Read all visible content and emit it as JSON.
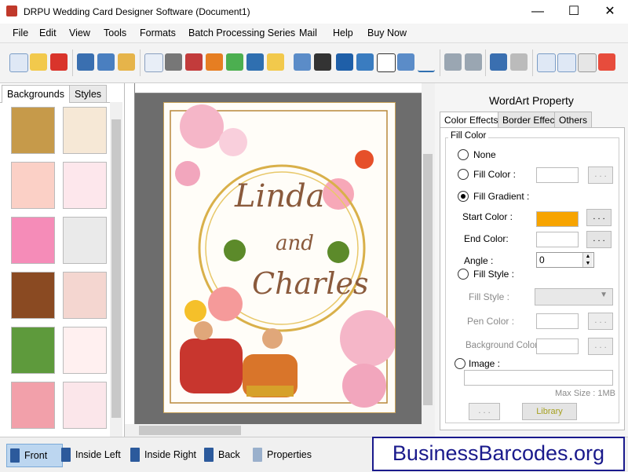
{
  "window": {
    "title": "DRPU Wedding Card Designer Software (Document1)",
    "controls": {
      "minimize": "—",
      "maximize": "☐",
      "close": "✕"
    }
  },
  "menu": [
    "File",
    "Edit",
    "View",
    "Tools",
    "Formats",
    "Batch Processing Series",
    "Mail",
    "Help",
    "Buy Now"
  ],
  "left_panel": {
    "tabs": [
      "Backgrounds",
      "Styles"
    ]
  },
  "card": {
    "name1": "Linda",
    "name2": "and",
    "name3": "Charles"
  },
  "wordart": {
    "title": "WordArt Property",
    "tabs": [
      "Color Effects",
      "Border Effect",
      "Others"
    ],
    "fill_color_group": "Fill Color",
    "none": "None",
    "fill_color": "Fill Color :",
    "fill_gradient": "Fill Gradient :",
    "start_color": "Start Color :",
    "start_color_value": "#f7a400",
    "end_color": "End Color:",
    "angle": "Angle :",
    "angle_value": "0",
    "fill_style_radio": "Fill Style :",
    "fill_style_label": "Fill Style :",
    "pen_color": "Pen Color :",
    "background_color": "Background Color :",
    "image": "Image :",
    "max_size": "Max Size : 1MB",
    "dots": ". . .",
    "library": "Library"
  },
  "bottom": {
    "buttons": [
      "Front",
      "Inside Left",
      "Inside Right",
      "Back",
      "Properties"
    ]
  },
  "watermark": "BusinessBarcodes.org"
}
